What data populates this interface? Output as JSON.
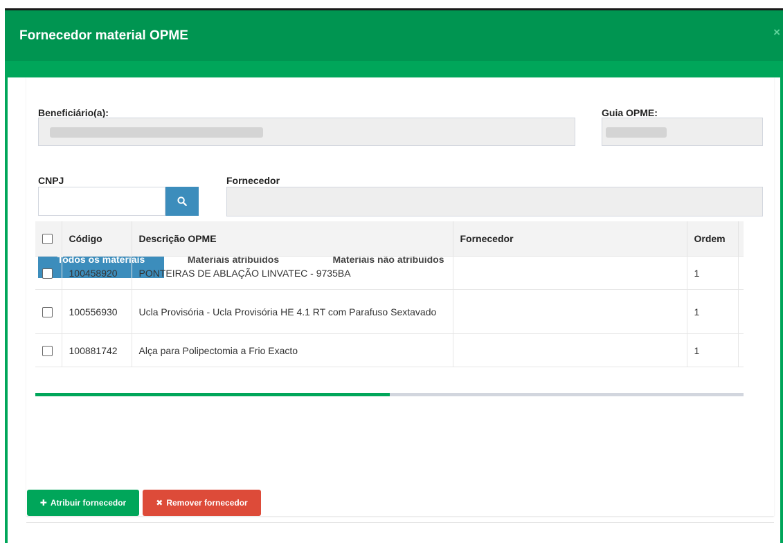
{
  "modal": {
    "title": "Fornecedor material OPME",
    "close_symbol": "×"
  },
  "form": {
    "beneficiario_label": "Beneficiário(a):",
    "guia_label": "Guia OPME:",
    "cnpj_label": "CNPJ",
    "cnpj_value": "",
    "fornecedor_label": "Fornecedor",
    "fornecedor_value": ""
  },
  "tabs": [
    {
      "label": "Todos os materiais",
      "active": true
    },
    {
      "label": "Materiais atribuidos",
      "active": false
    },
    {
      "label": "Materiais não atribuidos",
      "active": false
    }
  ],
  "table": {
    "headers": [
      "Código",
      "Descrição OPME",
      "Fornecedor",
      "Ordem"
    ],
    "rows": [
      {
        "codigo": "100458920",
        "descricao": "PONTEIRAS DE ABLAÇÃO LINVATEC - 9735BA",
        "fornecedor": "",
        "ordem": "1"
      },
      {
        "codigo": "100556930",
        "descricao": "Ucla Provisória - Ucla Provisória HE 4.1 RT com Parafuso Sextavado",
        "fornecedor": "",
        "ordem": "1"
      },
      {
        "codigo": "100881742",
        "descricao": "Alça para Polipectomia a Frio Exacto",
        "fornecedor": "",
        "ordem": "1"
      }
    ]
  },
  "buttons": {
    "assign_label": "Atribuir fornecedor",
    "remove_label": "Remover fornecedor"
  },
  "icons": {
    "search": "search-icon",
    "plus": "plus-icon",
    "remove": "times-icon",
    "close": "close-icon"
  },
  "colors": {
    "header_green": "#009551",
    "frame_green": "#00a65a",
    "tab_active_blue": "#3c8dbc",
    "remove_red": "#dd4b39",
    "scroll_thumb": "#00a65a"
  },
  "scroll": {
    "position_fraction": 0.5
  }
}
